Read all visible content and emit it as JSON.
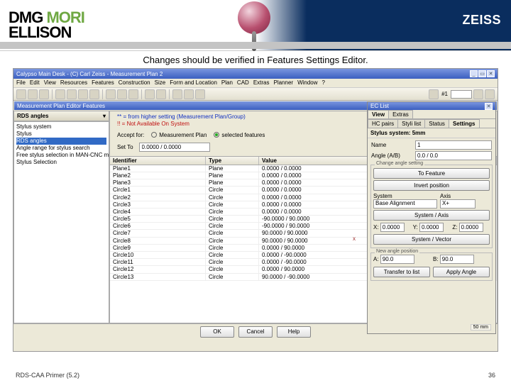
{
  "banner": {
    "logo_line1_a": "DMG ",
    "logo_line1_b": "MORI",
    "logo_line2": "ELLISON",
    "zeiss": "ZEISS"
  },
  "caption": "Changes should be verified in Features Settings Editor.",
  "app_title": "Calypso Main Desk - (C) Carl Zeiss - Measurement Plan 2",
  "menus": [
    "File",
    "Edit",
    "View",
    "Resources",
    "Features",
    "Construction",
    "Size",
    "Form and Location",
    "Plan",
    "CAD",
    "Extras",
    "Planner",
    "Window",
    "?"
  ],
  "toolbar_num": "#1",
  "sub_title": "Measurement Plan Editor Features",
  "left": {
    "tab": "RDS angles",
    "items": [
      "Stylus system",
      "Stylus",
      "RDS angles",
      "Angle range for stylus search",
      "Free stylus selection in MAN-CNC mode",
      "Stylus Selection"
    ],
    "selected_index": 2
  },
  "legend": {
    "l1": "** = from higher setting (Measurement Plan/Group)",
    "l2": "!! = Not Available On System"
  },
  "accept": {
    "label": "Accept for:",
    "opt1": "Measurement Plan",
    "opt2": "selected features"
  },
  "setto": {
    "label": "Set To",
    "value": "0.0000 / 0.0000"
  },
  "table": {
    "headers": [
      "Identifier",
      "Type",
      "Value"
    ],
    "rows": [
      [
        "Plane1",
        "Plane",
        "0.0000 / 0.0000"
      ],
      [
        "Plane2",
        "Plane",
        "0.0000 / 0.0000"
      ],
      [
        "Plane3",
        "Plane",
        "0.0000 / 0.0000"
      ],
      [
        "Circle1",
        "Circle",
        "0.0000 / 0.0000"
      ],
      [
        "Circle2",
        "Circle",
        "0.0000 / 0.0000"
      ],
      [
        "Circle3",
        "Circle",
        "0.0000 / 0.0000"
      ],
      [
        "Circle4",
        "Circle",
        "0.0000 / 0.0000"
      ],
      [
        "Circle5",
        "Circle",
        "-90.0000 / 90.0000"
      ],
      [
        "Circle6",
        "Circle",
        "-90.0000 / 90.0000"
      ],
      [
        "Circle7",
        "Circle",
        "90.0000 / 90.0000"
      ],
      [
        "Circle8",
        "Circle",
        "90.0000 / 90.0000"
      ],
      [
        "Circle9",
        "Circle",
        "0.0000 / 90.0000"
      ],
      [
        "Circle10",
        "Circle",
        "0.0000 / -90.0000"
      ],
      [
        "Circle11",
        "Circle",
        "0.0000 / -90.0000"
      ],
      [
        "Circle12",
        "Circle",
        "0.0000 / 90.0000"
      ],
      [
        "Circle13",
        "Circle",
        "90.0000 / -90.0000"
      ]
    ]
  },
  "buttons": {
    "ok": "OK",
    "cancel": "Cancel",
    "help": "Help"
  },
  "right": {
    "tabs_top": [
      "View",
      "Extras"
    ],
    "tabs_mid": [
      "HC pairs",
      "Styli list",
      "Status",
      "Settings"
    ],
    "stylus_label": "Stylus system: 5mm",
    "name_label": "Name",
    "name_value": "1",
    "angle_label": "Angle (A/B)",
    "angle_value": "0.0 / 0.0",
    "grp1": "Change angle setting",
    "tofeature": "To Feature",
    "invert": "Invert position",
    "system_label": "System",
    "system_value": "Base Alignment",
    "axis_label": "Axis",
    "axis_value": "X+",
    "sysaxis": "System / Axis",
    "x_label": "X:",
    "x_val": "0.0000",
    "y_label": "Y:",
    "y_val": "0.0000",
    "z_label": "Z:",
    "z_val": "0.0000",
    "sysvec": "System / Vector",
    "grp2": "New angle position",
    "a_label": "A:",
    "a_val": "90.0",
    "b_label": "B:",
    "b_val": "90.0",
    "transfer": "Transfer to list",
    "apply": "Apply Angle",
    "scale": "50 mm"
  },
  "axis_mark": "x",
  "footer": {
    "left": "RDS-CAA Primer (5.2)",
    "right": "36"
  }
}
